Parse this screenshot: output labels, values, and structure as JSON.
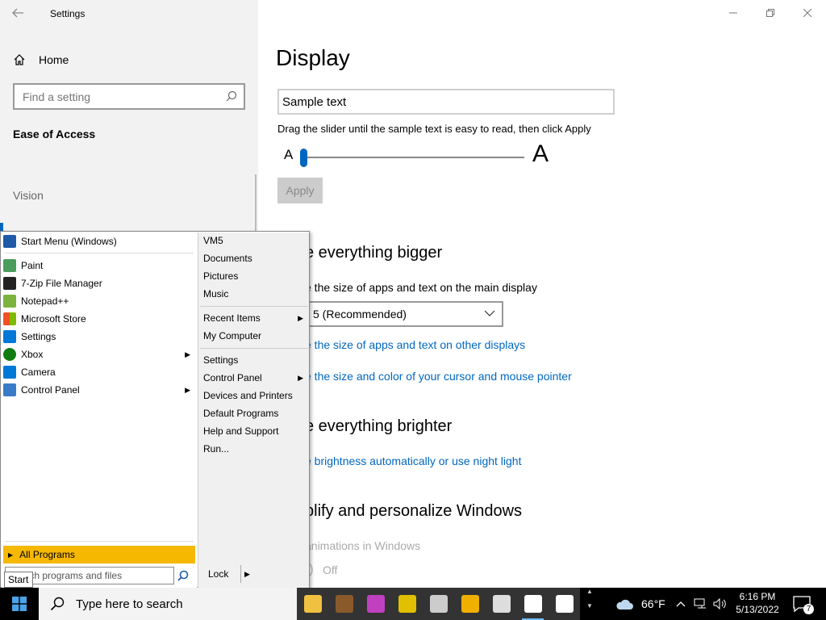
{
  "window": {
    "title": "Settings",
    "caption": {
      "minimize": "—",
      "maximize": "❐",
      "close": "✕"
    }
  },
  "sidebar": {
    "home_label": "Home",
    "search_placeholder": "Find a setting",
    "section_title": "Ease of Access",
    "group_label": "Vision"
  },
  "main": {
    "page_title": "Display",
    "sample_text": "Sample text",
    "slider_hint": "Drag the slider until the sample text is easy to read, then click Apply",
    "slider_small_label": "A",
    "slider_large_label": "A",
    "slider_value": 0,
    "apply_label": "Apply",
    "bigger_heading": "e everything bigger",
    "bigger_sub": "e the size of apps and text on the main display",
    "scale_value": "5 (Recommended)",
    "link_other_displays": "e the size of apps and text on other displays",
    "link_cursor": "e the size and color of your cursor and mouse pointer",
    "brighter_heading": "e everything brighter",
    "link_brightness": "e brightness automatically or use night light",
    "simplify_heading": "plify and personalize Windows",
    "animations_label": "animations in Windows",
    "toggle_state": "Off"
  },
  "start_menu": {
    "pinned": [
      {
        "label": "Start Menu (Windows)",
        "icon": "start-menu-icon",
        "color": "#1e5aa8"
      }
    ],
    "programs": [
      {
        "label": "Paint",
        "icon": "paint-icon",
        "color": "#4a9d5b",
        "submenu": false
      },
      {
        "label": "7-Zip File Manager",
        "icon": "7zip-icon",
        "color": "#222222",
        "submenu": false
      },
      {
        "label": "Notepad++",
        "icon": "notepadpp-icon",
        "color": "#7bb33d",
        "submenu": false
      },
      {
        "label": "Microsoft Store",
        "icon": "store-icon",
        "color": "#f25022",
        "submenu": false
      },
      {
        "label": "Settings",
        "icon": "settings-gear-icon",
        "color": "#0078d7",
        "submenu": false
      },
      {
        "label": "Xbox",
        "icon": "xbox-icon",
        "color": "#107c10",
        "submenu": true
      },
      {
        "label": "Camera",
        "icon": "camera-icon",
        "color": "#0078d7",
        "submenu": false
      },
      {
        "label": "Control Panel",
        "icon": "control-panel-icon",
        "color": "#3a7bc8",
        "submenu": true
      }
    ],
    "all_programs": "All Programs",
    "search_text": "Search programs and files",
    "right_items": [
      {
        "label": "VM5",
        "submenu": false
      },
      {
        "label": "Documents",
        "submenu": false
      },
      {
        "label": "Pictures",
        "submenu": false
      },
      {
        "label": "Music",
        "submenu": false
      },
      {
        "label": "Recent Items",
        "submenu": true
      },
      {
        "label": "My Computer",
        "submenu": false
      },
      {
        "label": "Settings",
        "submenu": false
      },
      {
        "label": "Control Panel",
        "submenu": true
      },
      {
        "label": "Devices and Printers",
        "submenu": false
      },
      {
        "label": "Default Programs",
        "submenu": false
      },
      {
        "label": "Help and Support",
        "submenu": false
      },
      {
        "label": "Run...",
        "submenu": false
      }
    ],
    "lock_label": "Lock",
    "tooltip": "Start"
  },
  "taskbar": {
    "search_placeholder": "Type here to search",
    "apps": [
      {
        "name": "file-explorer-icon",
        "color": "#f0c040",
        "active": false
      },
      {
        "name": "coffee-app-icon",
        "color": "#8b5a2b",
        "active": false
      },
      {
        "name": "color-app-icon",
        "color": "#c040c0",
        "active": false
      },
      {
        "name": "notes-app-icon",
        "color": "#e0c000",
        "active": false
      },
      {
        "name": "sky-app-icon",
        "color": "#cccccc",
        "active": false
      },
      {
        "name": "security-app-icon",
        "color": "#f0b000",
        "active": false
      },
      {
        "name": "server-app-icon",
        "color": "#dddddd",
        "active": false
      },
      {
        "name": "settings-app-icon",
        "color": "#ffffff",
        "active": true
      },
      {
        "name": "camera-app-icon",
        "color": "#ffffff",
        "active": false
      }
    ],
    "weather": "66°F",
    "time": "6:16 PM",
    "date": "5/13/2022",
    "notification_count": "7"
  }
}
